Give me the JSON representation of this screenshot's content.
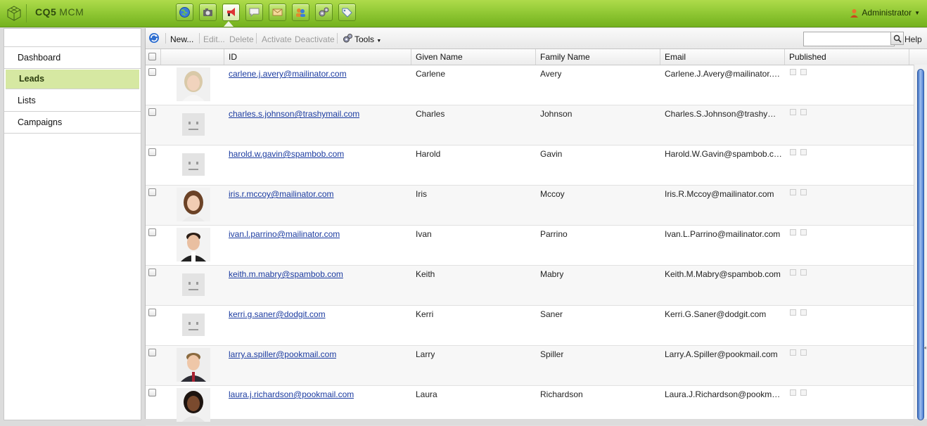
{
  "app": {
    "brand_primary": "CQ5",
    "brand_secondary": "MCM",
    "accent": "#8cc531"
  },
  "top_icons": [
    "globe-icon",
    "camera-icon",
    "megaphone-icon",
    "speech-bubble-icon",
    "envelope-icon",
    "community-icon",
    "gears-icon",
    "tag-icon"
  ],
  "user": {
    "name": "Administrator"
  },
  "nav": {
    "items": [
      {
        "label": "Dashboard",
        "selected": false
      },
      {
        "label": "Leads",
        "selected": true
      },
      {
        "label": "Lists",
        "selected": false
      },
      {
        "label": "Campaigns",
        "selected": false
      }
    ]
  },
  "toolbar": {
    "new": "New...",
    "edit": "Edit...",
    "delete": "Delete",
    "activate": "Activate",
    "deactivate": "Deactivate",
    "tools": "Tools",
    "search_value": "",
    "help": "Help"
  },
  "columns": {
    "id": "ID",
    "given": "Given Name",
    "family": "Family Name",
    "email": "Email",
    "published": "Published"
  },
  "rows": [
    {
      "id": "carlene.j.avery@mailinator.com",
      "given": "Carlene",
      "family": "Avery",
      "email": "Carlene.J.Avery@mailinator.com",
      "photo": "woman-light-hair"
    },
    {
      "id": "charles.s.johnson@trashymail.com",
      "given": "Charles",
      "family": "Johnson",
      "email": "Charles.S.Johnson@trashymail.c...",
      "photo": "placeholder"
    },
    {
      "id": "harold.w.gavin@spambob.com",
      "given": "Harold",
      "family": "Gavin",
      "email": "Harold.W.Gavin@spambob.com",
      "photo": "placeholder"
    },
    {
      "id": "iris.r.mccoy@mailinator.com",
      "given": "Iris",
      "family": "Mccoy",
      "email": "Iris.R.Mccoy@mailinator.com",
      "photo": "woman-brown-hair"
    },
    {
      "id": "ivan.l.parrino@mailinator.com",
      "given": "Ivan",
      "family": "Parrino",
      "email": "Ivan.L.Parrino@mailinator.com",
      "photo": "man-dark-hair"
    },
    {
      "id": "keith.m.mabry@spambob.com",
      "given": "Keith",
      "family": "Mabry",
      "email": "Keith.M.Mabry@spambob.com",
      "photo": "placeholder"
    },
    {
      "id": "kerri.g.saner@dodgit.com",
      "given": "Kerri",
      "family": "Saner",
      "email": "Kerri.G.Saner@dodgit.com",
      "photo": "placeholder"
    },
    {
      "id": "larry.a.spiller@pookmail.com",
      "given": "Larry",
      "family": "Spiller",
      "email": "Larry.A.Spiller@pookmail.com",
      "photo": "man-light-hair"
    },
    {
      "id": "laura.j.richardson@pookmail.com",
      "given": "Laura",
      "family": "Richardson",
      "email": "Laura.J.Richardson@pookmail.c...",
      "photo": "woman-dark-skin"
    }
  ]
}
